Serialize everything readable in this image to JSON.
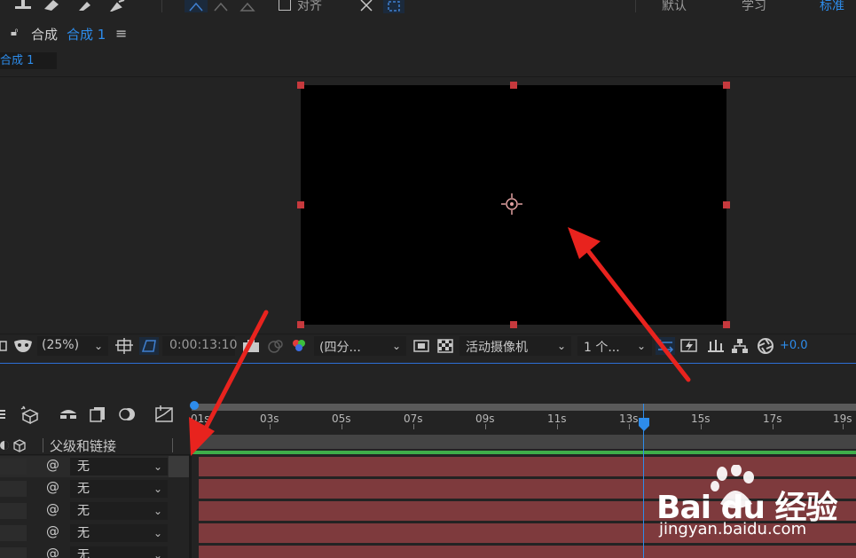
{
  "toolbar": {
    "align_label": "对齐",
    "workspaces": [
      "默认",
      "学习",
      "标准"
    ]
  },
  "comp_panel": {
    "label": "合成",
    "name": "合成 1",
    "tab": "合成 1"
  },
  "viewer_bar": {
    "zoom": "(25%)",
    "timecode": "0:00:13:10",
    "resolution": "(四分...",
    "camera": "活动摄像机",
    "views": "1 个...",
    "exposure": "+0.0"
  },
  "timeline": {
    "ticks": [
      "01s",
      "03s",
      "05s",
      "07s",
      "09s",
      "11s",
      "13s",
      "15s",
      "17s",
      "19s"
    ],
    "column_header": "父级和链接",
    "layers": [
      {
        "parent": "无"
      },
      {
        "parent": "无"
      },
      {
        "parent": "无"
      },
      {
        "parent": "无"
      },
      {
        "parent": "无"
      }
    ]
  },
  "watermark": {
    "brand": "Bai du 经验",
    "url": "jingyan.baidu.com"
  },
  "colors": {
    "accent": "#2d8ceb",
    "layer_bar": "#7e3a3d",
    "handle": "#c6393d",
    "arrow": "#e8231e"
  }
}
